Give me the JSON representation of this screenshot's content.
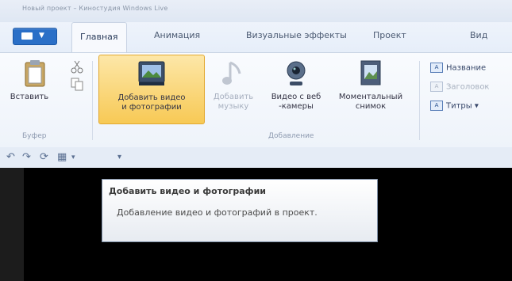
{
  "window": {
    "title": "Новый проект – Киностудия Windows Live"
  },
  "tabs": [
    {
      "label": "Главная"
    },
    {
      "label": "Анимация"
    },
    {
      "label": "Визуальные эффекты"
    },
    {
      "label": "Проект"
    },
    {
      "label": "Вид"
    }
  ],
  "ribbon": {
    "clipboard": {
      "paste_label": "Вставить",
      "group_label": "Буфер"
    },
    "add": {
      "add_video_photos": [
        "Добавить видео",
        "и фотографии"
      ],
      "add_music": [
        "Добавить",
        "музыку"
      ],
      "webcam": [
        "Видео с веб",
        "-камеры"
      ],
      "snapshot": [
        "Моментальный",
        "снимок"
      ],
      "group_label": "Добавление"
    },
    "right": {
      "title_label": "Название",
      "caption_label": "Заголовок",
      "credits_label": "Титры"
    }
  },
  "tooltip": {
    "title": "Добавить видео и фотографии",
    "body": "Добавление видео и фотографий в проект."
  },
  "icons": {
    "file_button": "app-menu-icon",
    "paste": "clipboard-icon",
    "cut": "scissors-icon",
    "copy": "copy-icon",
    "add_video": "video-photo-icon",
    "music": "music-note-icon",
    "webcam": "webcam-icon",
    "snapshot": "snapshot-icon"
  }
}
